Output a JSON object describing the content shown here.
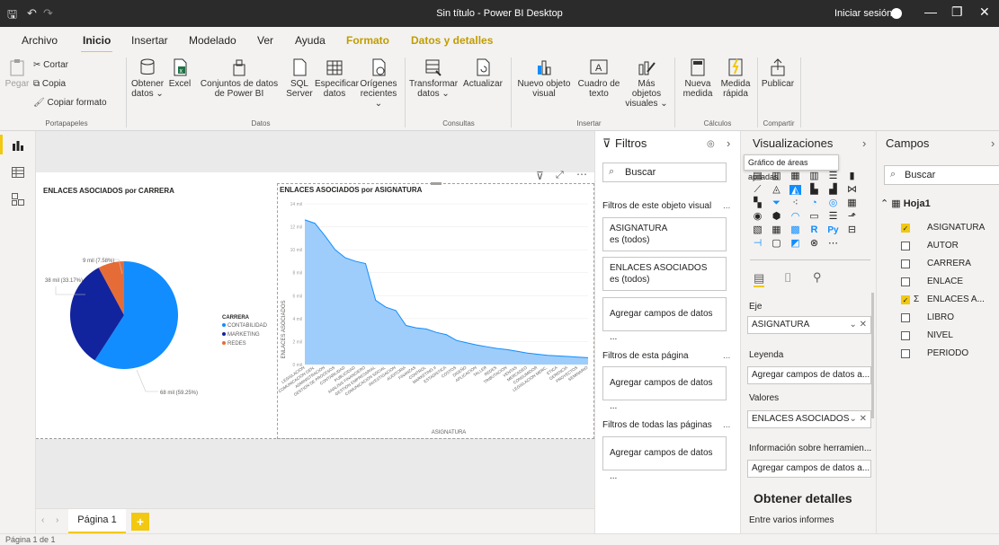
{
  "window": {
    "title": "Sin título - Power BI Desktop",
    "signin": "Iniciar sesión"
  },
  "menu": {
    "tabs": [
      "Archivo",
      "Inicio",
      "Insertar",
      "Modelado",
      "Ver",
      "Ayuda",
      "Formato",
      "Datos y detalles"
    ],
    "active": "Inicio"
  },
  "ribbon": {
    "paste": "Pegar",
    "cut": "Cortar",
    "copy": "Copia",
    "copy_format": "Copiar formato",
    "get_data": "Obtener datos ⌄",
    "excel": "Excel",
    "datasets": "Conjuntos de datos de Power BI",
    "sql": "SQL Server",
    "enter_data": "Especificar datos",
    "recent": "Orígenes recientes ⌄",
    "transform": "Transformar datos ⌄",
    "refresh": "Actualizar",
    "new_visual": "Nuevo objeto visual",
    "text_box": "Cuadro de texto",
    "more_visuals": "Más objetos visuales ⌄",
    "new_measure": "Nueva medida",
    "quick_measure": "Medida rápida",
    "publish": "Publicar",
    "groups": {
      "clipboard": "Portapapeles",
      "data": "Datos",
      "queries": "Consultas",
      "insert": "Insertar",
      "calc": "Cálculos",
      "share": "Compartir"
    }
  },
  "canvas": {
    "pie_title": "ENLACES ASOCIADOS por CARRERA",
    "area_title": "ENLACES ASOCIADOS por ASIGNATURA",
    "pie_labels": {
      "redes": "9 mil (7.58%)",
      "marketing": "38 mil (33.17%)",
      "contabilidad": "68 mil (59.25%)"
    },
    "legend_title": "CARRERA",
    "area_ylabel": "ENLACES ASOCIADOS",
    "area_xlabel": "ASIGNATURA"
  },
  "chart_data": [
    {
      "type": "pie",
      "title": "ENLACES ASOCIADOS por CARRERA",
      "categories": [
        "CONTABILIDAD",
        "MARKETING",
        "REDES"
      ],
      "values": [
        68000,
        38000,
        9000
      ],
      "percents": [
        59.25,
        33.17,
        7.58
      ],
      "colors": [
        "#118dff",
        "#12239e",
        "#e66c37"
      ],
      "legend": "right"
    },
    {
      "type": "area",
      "title": "ENLACES ASOCIADOS por ASIGNATURA",
      "xlabel": "ASIGNATURA",
      "ylabel": "ENLACES ASOCIADOS",
      "ylim": [
        0,
        14000
      ],
      "yticks": [
        "0 mil",
        "2 mil",
        "4 mil",
        "6 mil",
        "8 mil",
        "10 mil",
        "12 mil",
        "14 mil"
      ],
      "categories": [
        "LEGISLACION",
        "COMUNICACION GEN.",
        "ADMINISTRACION",
        "GESTION DE PROCESOS",
        "CONTABILIDAD",
        "PUBLICIDAD",
        "ANALISIS FINANCIERO",
        "GESTION EMPRESARIAL",
        "COMUNICACION SOCIAL",
        "INVESTIGACION",
        "AUDITORIA",
        "FINANZAS",
        "CONTROL",
        "MARKETING II",
        "ESTADISTICA",
        "COSTOS",
        "DISEÑO",
        "APLICACION",
        "TALLER",
        "REDES",
        "TRIBUTACION",
        "VENTAS",
        "MERCADEO",
        "CONSUMIDOR",
        "LEGISLACION MERC.",
        "ETICA",
        "GERENCIA",
        "PROYECTOS",
        "SEMINARIO"
      ],
      "values": [
        12600,
        12300,
        11200,
        10000,
        9300,
        9000,
        8800,
        5600,
        5000,
        4700,
        3400,
        3200,
        3100,
        2800,
        2600,
        2100,
        1900,
        1700,
        1550,
        1400,
        1300,
        1150,
        1000,
        900,
        800,
        750,
        700,
        650,
        600
      ],
      "color": "#118dff"
    }
  ],
  "filters": {
    "title": "Filtros",
    "search": "Buscar",
    "visual_section": "Filtros de este objeto visual",
    "f1_field": "ASIGNATURA",
    "f1_state": "es (todos)",
    "f2_field": "ENLACES ASOCIADOS",
    "f2_state": "es (todos)",
    "add": "Agregar campos de datos ...",
    "page_section": "Filtros de esta página",
    "all_section": "Filtros de todas las páginas",
    "dots": "..."
  },
  "viz": {
    "title": "Visualizaciones",
    "tooltip": "Gráfico de áreas apiladas",
    "axis": "Eje",
    "axis_value": "ASIGNATURA",
    "legend": "Leyenda",
    "legend_add": "Agregar campos de datos a...",
    "values": "Valores",
    "values_value": "ENLACES ASOCIADOS",
    "tooltips": "Información sobre herramien...",
    "tooltips_add": "Agregar campos de datos a...",
    "drill": "Obtener detalles",
    "cross": "Entre varios informes"
  },
  "fields": {
    "title": "Campos",
    "search": "Buscar",
    "table": "Hoja1",
    "items": [
      {
        "name": "ASIGNATURA",
        "checked": true,
        "sigma": false
      },
      {
        "name": "AUTOR",
        "checked": false,
        "sigma": false
      },
      {
        "name": "CARRERA",
        "checked": false,
        "sigma": false
      },
      {
        "name": "ENLACE",
        "checked": false,
        "sigma": false
      },
      {
        "name": "ENLACES A...",
        "checked": true,
        "sigma": true
      },
      {
        "name": "LIBRO",
        "checked": false,
        "sigma": false
      },
      {
        "name": "NIVEL",
        "checked": false,
        "sigma": false
      },
      {
        "name": "PERIODO",
        "checked": false,
        "sigma": false
      }
    ]
  },
  "pages": {
    "tab": "Página 1",
    "add": "+",
    "status": "Página 1 de 1"
  }
}
